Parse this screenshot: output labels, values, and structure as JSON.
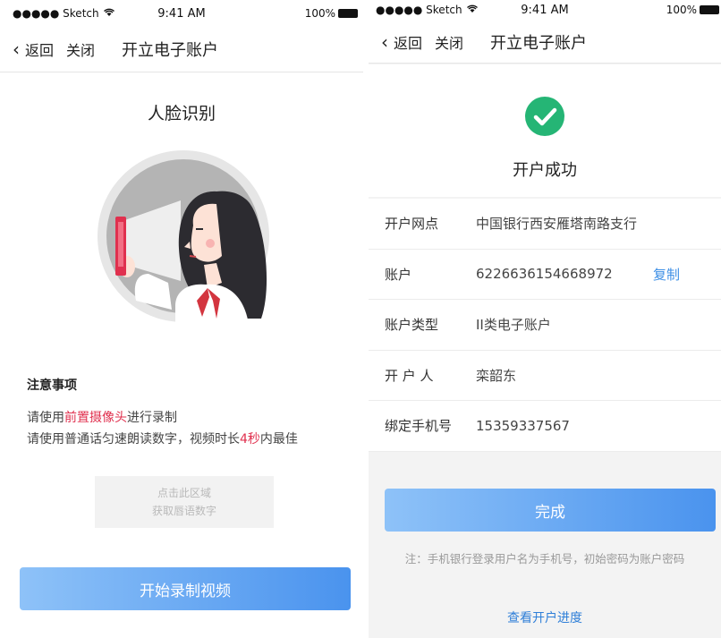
{
  "status_bar": {
    "carrier": "●●●●● Sketch",
    "time": "9:41 AM",
    "battery": "100%"
  },
  "nav": {
    "back": "返回",
    "close": "关闭",
    "title": "开立电子账户"
  },
  "face_screen": {
    "heading": "人脸识别",
    "notes_title": "注意事项",
    "note1": {
      "prefix": "请使用",
      "highlight": "前置摄像头",
      "suffix": "进行录制"
    },
    "note2": {
      "prefix": "请使用普通话匀速朗读数字，视频时长",
      "highlight": "4秒",
      "suffix": "内最佳"
    },
    "capture_box": {
      "line1": "点击此区域",
      "line2": "获取唇语数字"
    },
    "start_button": "开始录制视频"
  },
  "success_screen": {
    "success_text": "开户成功",
    "rows": [
      {
        "label": "开户网点",
        "value": "中国银行西安雁塔南路支行"
      },
      {
        "label": "账户",
        "value": "6226636154668972",
        "action": "复制"
      },
      {
        "label": "账户类型",
        "value": "II类电子账户"
      },
      {
        "label": "开 户 人",
        "value": "栾韶东"
      },
      {
        "label": "绑定手机号",
        "value": "15359337567"
      }
    ],
    "done_button": "完成",
    "tip": "注：手机银行登录用户名为手机号，初始密码为账户密码",
    "progress_link": "查看开户进度"
  },
  "colors": {
    "accent_blue": "#4a93ee",
    "success_green": "#25b575",
    "highlight_red": "#e0304e",
    "link_blue": "#2f7fd8"
  },
  "icons": [
    "wifi-icon",
    "battery-icon",
    "chevron-left-icon",
    "checkmark-circle-icon",
    "face-illustration"
  ]
}
